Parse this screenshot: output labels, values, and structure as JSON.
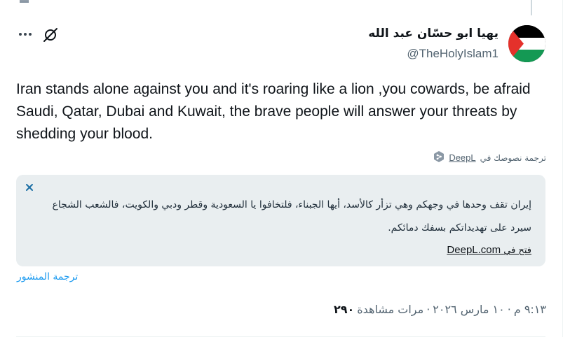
{
  "tweet": {
    "author": {
      "display_name": "يهيا ابو حسّان عبد الله",
      "handle": "@TheHolyIslam1",
      "avatar": "palestine-flag-avatar"
    },
    "text": "Iran stands alone against you and it's roaring like a lion ,you cowards, be afraid Saudi, Qatar, Dubai and Kuwait, the brave people will answer your threats by shedding your blood.",
    "translation_notice": {
      "prefix": "ترجمة نصوصك في",
      "link": "DeepL"
    },
    "translation": {
      "text": "إيران تقف وحدها في وجهكم وهي تزأر كالأسد، أيها الجبناء، فلتخافوا يا السعودية وقطر ودبي والكويت، فالشعب الشجاع سيرد على تهديداتكم بسفك دمائكم.",
      "open_prefix": "فتح في",
      "open_link": "DeepL.com"
    },
    "translate_post_label": "ترجمة المنشور",
    "meta": {
      "time": "٩:١٣ م",
      "date": "١٠ مارس ٢٠٢٦",
      "separator": "·",
      "views_count": "٢٩٠",
      "views_label": "مرات مشاهدة"
    }
  },
  "colors": {
    "link_blue": "#1d9bf0",
    "secondary_text": "#536471",
    "translation_bg": "#e9eef0"
  },
  "icons": [
    "more-icon",
    "grok-icon",
    "deepl-icon",
    "close-icon"
  ]
}
